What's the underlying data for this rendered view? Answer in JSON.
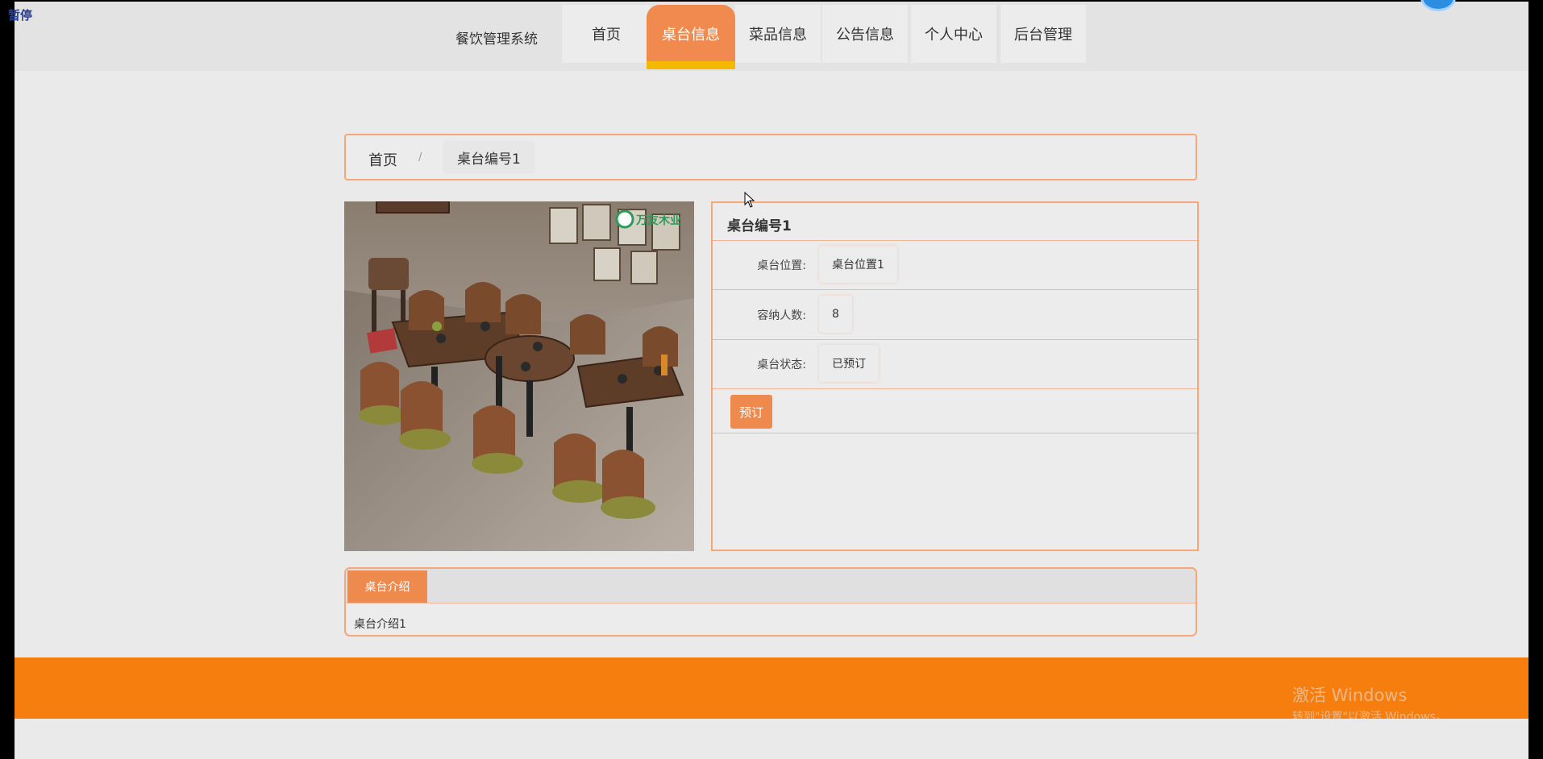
{
  "overlay": {
    "pause_label": "暂停"
  },
  "header": {
    "brand": "餐饮管理系统",
    "nav": [
      {
        "label": "首页",
        "active": false
      },
      {
        "label": "桌台信息",
        "active": true
      },
      {
        "label": "菜品信息",
        "active": false
      },
      {
        "label": "公告信息",
        "active": false
      },
      {
        "label": "个人中心",
        "active": false
      },
      {
        "label": "后台管理",
        "active": false
      }
    ]
  },
  "breadcrumb": {
    "home": "首页",
    "separator": "/",
    "current": "桌台编号1"
  },
  "detail": {
    "title": "桌台编号1",
    "fields": [
      {
        "label": "桌台位置:",
        "value": "桌台位置1"
      },
      {
        "label": "容纳人数:",
        "value": "8"
      },
      {
        "label": "桌台状态:",
        "value": "已预订"
      }
    ],
    "book_button": "预订"
  },
  "intro": {
    "tab": "桌台介绍",
    "text": "桌台介绍1"
  },
  "photo": {
    "logo_text": "万友木业"
  },
  "watermark": {
    "line1": "激活 Windows",
    "line2": "转到\"设置\"以激活 Windows。"
  },
  "colors": {
    "accent": "#ef8a4e",
    "footer": "#f67e0f",
    "nav_underline": "#f5b800",
    "border": "#f5a77a"
  }
}
